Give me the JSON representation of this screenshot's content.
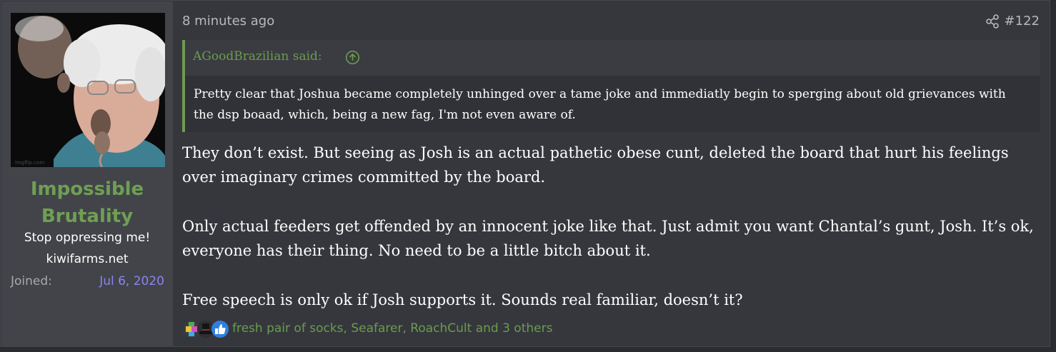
{
  "user": {
    "name": "Impossible Brutality",
    "title": "Stop oppressing me!",
    "site": "kiwifarms.net",
    "joined_label": "Joined:",
    "joined_date": "Jul 6, 2020"
  },
  "post": {
    "time": "8 minutes ago",
    "number": "#122"
  },
  "quote": {
    "author": "AGoodBrazilian said:",
    "text": "Pretty clear that Joshua became completely unhinged over a tame joke and immediatly begin to sperging about old grievances with the dsp boaad, which, being a new fag, I'm not even aware of."
  },
  "body": [
    "They don’t exist. But seeing as Josh is an actual pathetic obese cunt, deleted the board that hurt his feelings over imaginary crimes committed by the board.",
    "Only actual feeders get offended by an innocent joke like that. Just admit you want Chantal’s gunt, Josh. It’s ok, everyone has their thing. No need to be a little bitch about it.",
    "Free speech is only ok if Josh supports it. Sounds real familiar, doesn’t it?"
  ],
  "reactions": {
    "text": "fresh pair of socks, Seafarer, RoachCult and 3 others",
    "icons": [
      "puzzle-reaction-icon",
      "top-hat-reaction-icon",
      "thumbs-up-reaction-icon"
    ]
  },
  "colors": {
    "accent_green": "#6b9c4d",
    "date_purple": "#8c84f0",
    "panel_bg": "#424449",
    "post_bg": "#35373d"
  }
}
